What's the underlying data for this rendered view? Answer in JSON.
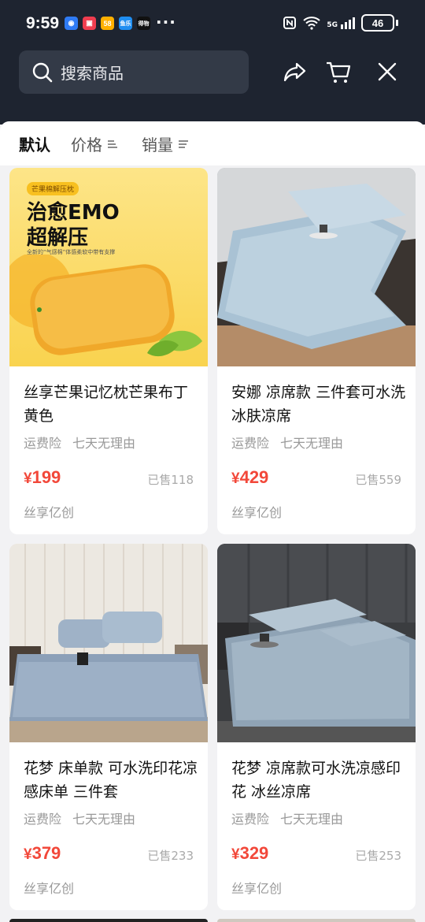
{
  "status_bar": {
    "time": "9:59",
    "apps": [
      {
        "name": "app-1",
        "color": "#2f7bf5",
        "label": ""
      },
      {
        "name": "app-2",
        "color": "#ef3d4f",
        "label": ""
      },
      {
        "name": "app-58",
        "color": "#ffb000",
        "label": "58"
      },
      {
        "name": "app-news",
        "color": "#1f8ef1",
        "label": "鱼乐"
      },
      {
        "name": "app-dewu",
        "color": "#111111",
        "label": "得物"
      }
    ],
    "overflow": "···",
    "network": "5G",
    "battery": "46"
  },
  "header": {
    "search_placeholder": "搜索商品"
  },
  "sort_tabs": [
    {
      "label": "默认",
      "active": true
    },
    {
      "label": "价格",
      "active": false
    },
    {
      "label": "销量",
      "active": false
    }
  ],
  "products": [
    {
      "title": "丝享芒果记忆枕芒果布丁黄色",
      "tags": [
        "运费险",
        "七天无理由"
      ],
      "price_symbol": "¥",
      "price": "199",
      "sold": "已售118",
      "shop": "丝享亿创",
      "image": {
        "badge": "芒果棉解压枕",
        "headline1": "治愈EMO",
        "headline2": "超解压",
        "sub": "全新的“气感棉”体感柔软中带有支撑"
      }
    },
    {
      "title": "安娜 凉席款 三件套可水洗冰肤凉席",
      "tags": [
        "运费险",
        "七天无理由"
      ],
      "price_symbol": "¥",
      "price": "429",
      "sold": "已售559",
      "shop": "丝享亿创"
    },
    {
      "title": "花梦 床单款 可水洗印花凉感床单 三件套",
      "tags": [
        "运费险",
        "七天无理由"
      ],
      "price_symbol": "¥",
      "price": "379",
      "sold": "已售233",
      "shop": "丝享亿创"
    },
    {
      "title": "花梦 凉席款可水洗凉感印花 冰丝凉席",
      "tags": [
        "运费险",
        "七天无理由"
      ],
      "price_symbol": "¥",
      "price": "329",
      "sold": "已售253",
      "shop": "丝享亿创"
    }
  ]
}
